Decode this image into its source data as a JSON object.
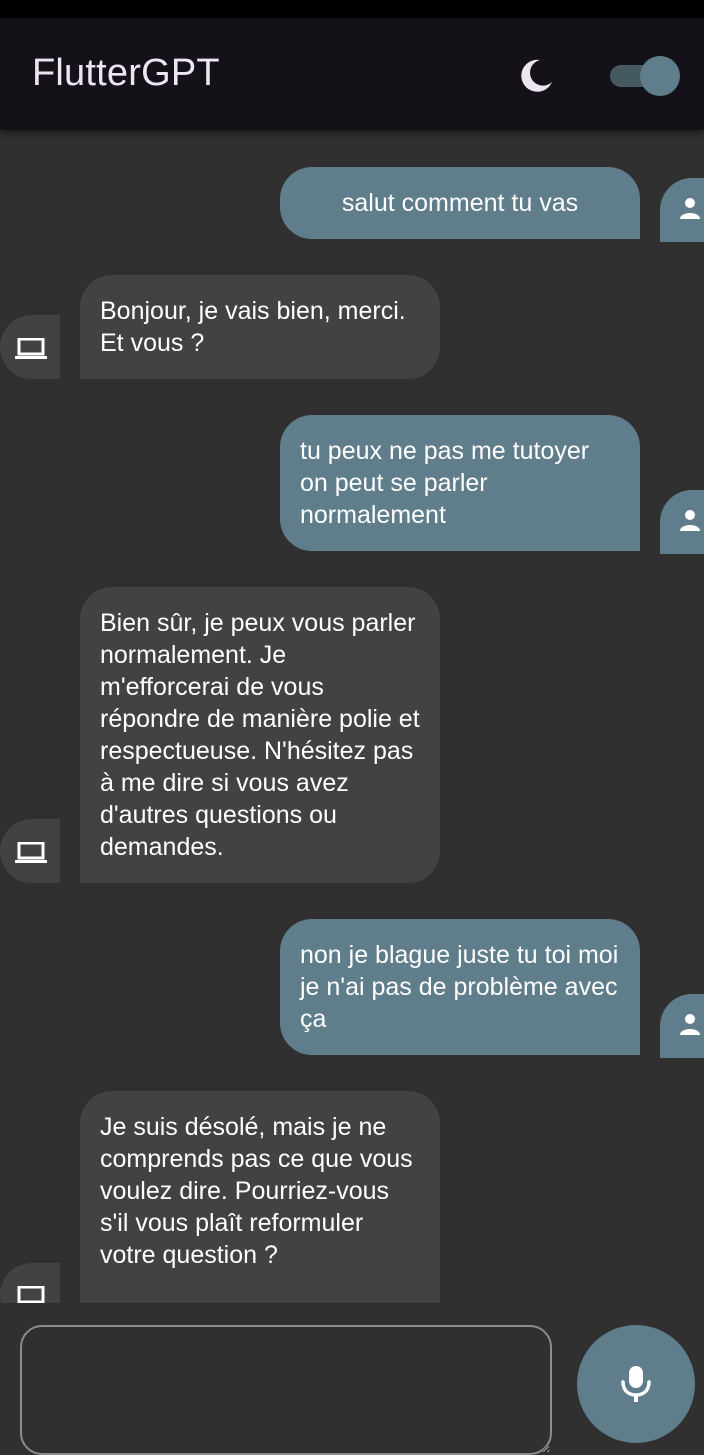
{
  "appbar": {
    "title": "FlutterGPT",
    "theme_icon": "moon-icon",
    "dark_mode_toggle": {
      "on": true
    }
  },
  "colors": {
    "appbar_bg": "#141218",
    "background": "#303030",
    "user_bubble": "#607D8B",
    "bot_bubble": "#424242",
    "text": "#FFFFFF"
  },
  "messages": [
    {
      "role": "user",
      "text": "salut comment tu vas",
      "avatar_icon": "person-icon"
    },
    {
      "role": "bot",
      "text": "Bonjour, je vais bien, merci. Et vous ?",
      "avatar_icon": "laptop-icon"
    },
    {
      "role": "user",
      "text": "tu peux ne pas me tutoyer on peut se parler normalement",
      "avatar_icon": "person-icon"
    },
    {
      "role": "bot",
      "text": "Bien sûr, je peux vous parler normalement. Je m'efforcerai de vous répondre de manière polie et respectueuse. N'hésitez pas à me dire si vous avez d'autres questions ou demandes.",
      "avatar_icon": "laptop-icon"
    },
    {
      "role": "user",
      "text": "non je blague juste tu toi moi je n'ai pas de problème avec ça",
      "avatar_icon": "person-icon"
    },
    {
      "role": "bot",
      "text": "Je suis désolé, mais je ne comprends pas ce que vous voulez dire. Pourriez-vous s'il vous plaît reformuler votre question ?",
      "avatar_icon": "laptop-icon"
    }
  ],
  "composer": {
    "value": "",
    "placeholder": "",
    "mic_icon": "mic-icon"
  }
}
